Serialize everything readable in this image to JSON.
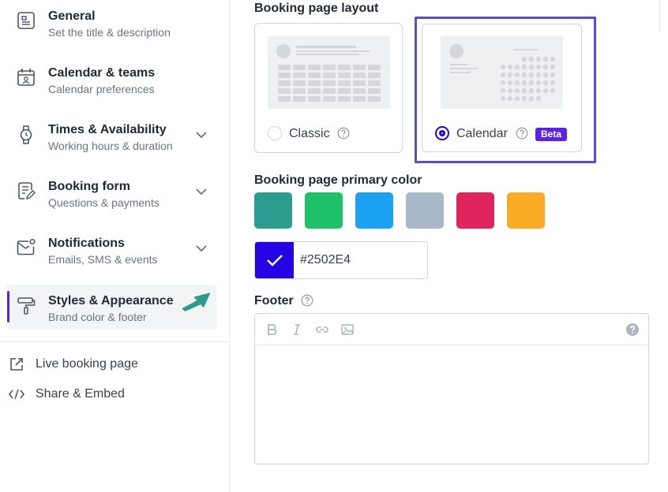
{
  "sidebar": {
    "items": [
      {
        "title": "General",
        "subtitle": "Set the title & description",
        "icon": "document-icon",
        "has_chevron": false
      },
      {
        "title": "Calendar & teams",
        "subtitle": "Calendar preferences",
        "icon": "calendar-user-icon",
        "has_chevron": false
      },
      {
        "title": "Times & Availability",
        "subtitle": "Working hours & duration",
        "icon": "watch-icon",
        "has_chevron": true
      },
      {
        "title": "Booking form",
        "subtitle": "Questions & payments",
        "icon": "form-edit-icon",
        "has_chevron": true
      },
      {
        "title": "Notifications",
        "subtitle": "Emails, SMS & events",
        "icon": "mail-notification-icon",
        "has_chevron": true
      },
      {
        "title": "Styles & Appearance",
        "subtitle": "Brand color & footer",
        "icon": "paint-roller-icon",
        "has_chevron": false,
        "active": true
      }
    ],
    "links": [
      {
        "label": "Live booking page",
        "icon": "external-link-icon"
      },
      {
        "label": "Share & Embed",
        "icon": "code-icon"
      }
    ]
  },
  "layout": {
    "label": "Booking page layout",
    "options": [
      {
        "label": "Classic",
        "selected": false
      },
      {
        "label": "Calendar",
        "selected": true,
        "badge": "Beta"
      }
    ]
  },
  "color": {
    "label": "Booking page primary color",
    "swatches": [
      "#2a9d8f",
      "#1fc16b",
      "#1da1f2",
      "#a9b9c9",
      "#e0245e",
      "#fbac27"
    ],
    "selected_hex": "#2502E4",
    "selected_color": "#2502E4"
  },
  "footer": {
    "label": "Footer",
    "toolbar": [
      "bold-icon",
      "italic-icon",
      "link-icon",
      "image-icon",
      "help-icon"
    ]
  },
  "accent_color": "#5b21e6"
}
